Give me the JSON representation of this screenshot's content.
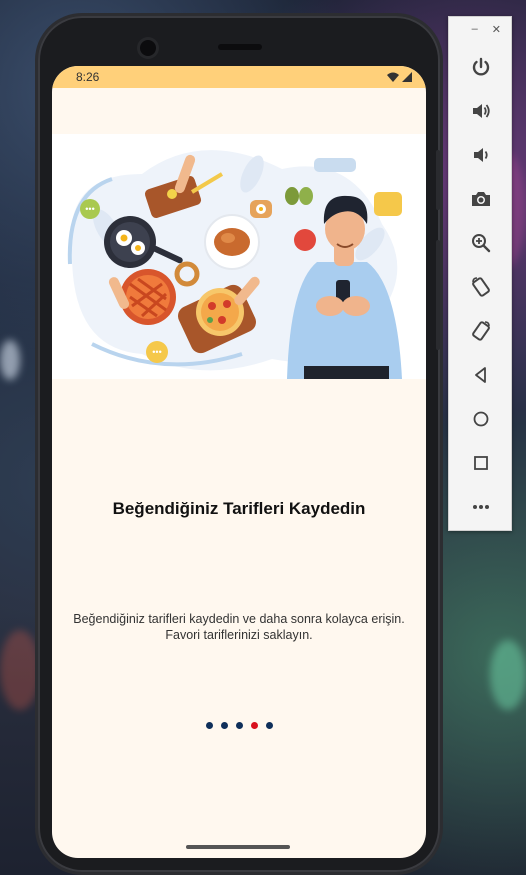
{
  "status_bar": {
    "time": "8:26"
  },
  "onboarding": {
    "title": "Beğendiğiniz Tarifleri Kaydedin",
    "description_line1": "Beğendiğiniz tarifleri kaydedin ve daha sonra kolayca erişin.",
    "description_line2": "Favori tariflerinizi saklayın.",
    "page_count": 5,
    "active_page": 4
  },
  "emulator_toolbar": {
    "window_controls": {
      "minimize": "–",
      "close": "✕"
    },
    "buttons": [
      "power-icon",
      "volume-up-icon",
      "volume-down-icon",
      "camera-icon",
      "zoom-icon",
      "rotate-left-icon",
      "rotate-right-icon",
      "back-icon",
      "home-icon",
      "overview-icon",
      "more-icon"
    ]
  },
  "colors": {
    "status_bar": "#ffd07a",
    "screen_bg": "#fff8ef",
    "dot_inactive": "#0f2f5a",
    "dot_active": "#d9111d"
  }
}
